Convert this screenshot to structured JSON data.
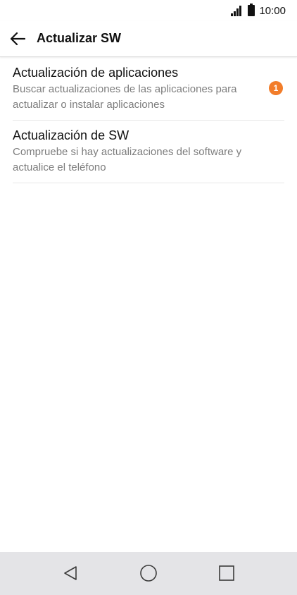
{
  "status_bar": {
    "time": "10:00",
    "icons": [
      "signal-icon",
      "battery-icon"
    ]
  },
  "app_bar": {
    "back_icon": "arrow-back-icon",
    "title": "Actualizar SW"
  },
  "list": {
    "items": [
      {
        "title": "Actualización de aplicaciones",
        "summary": "Buscar actualizaciones de las aplicaciones para actualizar o instalar aplicaciones",
        "badge": "1",
        "badge_color": "#f27d2a"
      },
      {
        "title": "Actualización de SW",
        "summary": "Compruebe si hay actualizaciones del software y actualice el teléfono"
      }
    ]
  },
  "nav_bar": {
    "buttons": [
      "back-triangle-icon",
      "home-circle-icon",
      "recents-square-icon"
    ]
  }
}
